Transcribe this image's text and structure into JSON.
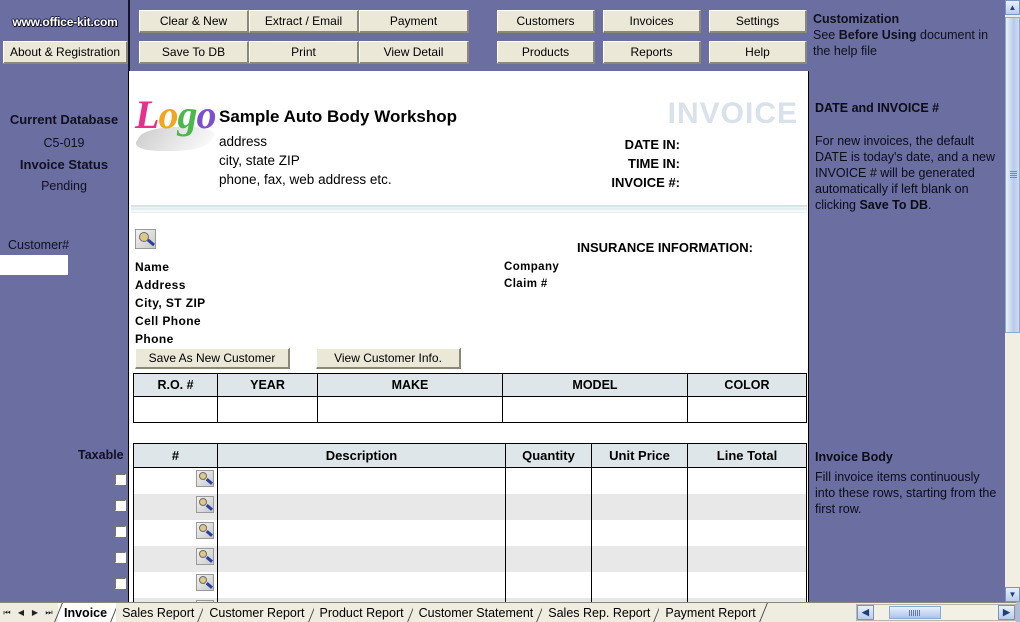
{
  "toolbar": {
    "brand_url": "www.office-kit.com",
    "about_button": "About & Registration",
    "buttons_left": [
      "Clear & New",
      "Extract / Email",
      "Payment",
      "Save To DB",
      "Print",
      "View Detail"
    ],
    "buttons_right": [
      "Customers",
      "Invoices",
      "Settings",
      "Products",
      "Reports",
      "Help"
    ],
    "customization": {
      "heading": "Customization",
      "line_prefix": "See ",
      "line_bold": "Before Using",
      "line_suffix": " document in the help file"
    }
  },
  "sidebar": {
    "current_database_label": "Current Database",
    "current_database_value": "C5-019",
    "invoice_status_label": "Invoice Status",
    "invoice_status_value": "Pending",
    "customer_number_label": "Customer#",
    "customer_number_value": "",
    "taxable_label": "Taxable"
  },
  "invoice": {
    "company_name": "Sample Auto Body Workshop",
    "address_line1": "address",
    "address_line2": "city, state ZIP",
    "address_line3": "phone, fax, web address etc.",
    "logo_text": "Logo",
    "title": "INVOICE",
    "date_in_label": "DATE IN:",
    "time_in_label": "TIME IN:",
    "invoice_no_label": "INVOICE #:",
    "date_in_value": "",
    "time_in_value": "",
    "invoice_no_value": "",
    "customer_fields": [
      "Name",
      "Address",
      "City, ST ZIP",
      "Cell Phone",
      "Phone"
    ],
    "insurance_title": "INSURANCE INFORMATION:",
    "insurance_fields": [
      "Company",
      "Claim #"
    ],
    "save_as_new_customer": "Save As New Customer",
    "view_customer_info": "View Customer Info.",
    "vehicle_table": {
      "headers": [
        "R.O. #",
        "YEAR",
        "MAKE",
        "MODEL",
        "COLOR"
      ],
      "row": [
        "",
        "",
        "",
        "",
        ""
      ]
    },
    "items_table": {
      "headers": [
        "#",
        "Description",
        "Quantity",
        "Unit Price",
        "Line Total"
      ],
      "rows": [
        {
          "num": "",
          "description": "",
          "quantity": "",
          "unit_price": "",
          "line_total": ""
        },
        {
          "num": "",
          "description": "",
          "quantity": "",
          "unit_price": "",
          "line_total": ""
        },
        {
          "num": "",
          "description": "",
          "quantity": "",
          "unit_price": "",
          "line_total": ""
        },
        {
          "num": "",
          "description": "",
          "quantity": "",
          "unit_price": "",
          "line_total": ""
        },
        {
          "num": "",
          "description": "",
          "quantity": "",
          "unit_price": "",
          "line_total": ""
        },
        {
          "num": "",
          "description": "",
          "quantity": "",
          "unit_price": "",
          "line_total": ""
        }
      ]
    }
  },
  "help": {
    "panel1": {
      "heading": "DATE and INVOICE #",
      "text_prefix": "For new invoices, the default DATE is today's date, and a new INVOICE # will be generated automatically if left blank  on clicking ",
      "text_bold": "Save To DB",
      "text_suffix": "."
    },
    "panel2": {
      "heading": "Invoice Body",
      "text": "Fill invoice items continuously into these rows, starting from the first row."
    }
  },
  "tabs": {
    "nav_first": "⏮",
    "nav_prev": "◀",
    "nav_next": "▶",
    "nav_last": "⏭",
    "items": [
      {
        "label": "Invoice",
        "active": true
      },
      {
        "label": "Sales Report",
        "active": false
      },
      {
        "label": "Customer Report",
        "active": false
      },
      {
        "label": "Product Report",
        "active": false
      },
      {
        "label": "Customer Statement",
        "active": false
      },
      {
        "label": "Sales Rep. Report",
        "active": false
      },
      {
        "label": "Payment Report",
        "active": false
      }
    ]
  },
  "scroll": {
    "up_arrow": "▲",
    "down_arrow": "▼",
    "left_arrow": "◀",
    "right_arrow": "▶"
  },
  "colors": {
    "app_background": "#6a6ea0",
    "button_face": "#ebe8d8",
    "table_header": "#dee6ea",
    "alt_row": "#e8e8e8",
    "invoice_watermark": "#d9e2ea",
    "tabbar": "#efece0"
  }
}
